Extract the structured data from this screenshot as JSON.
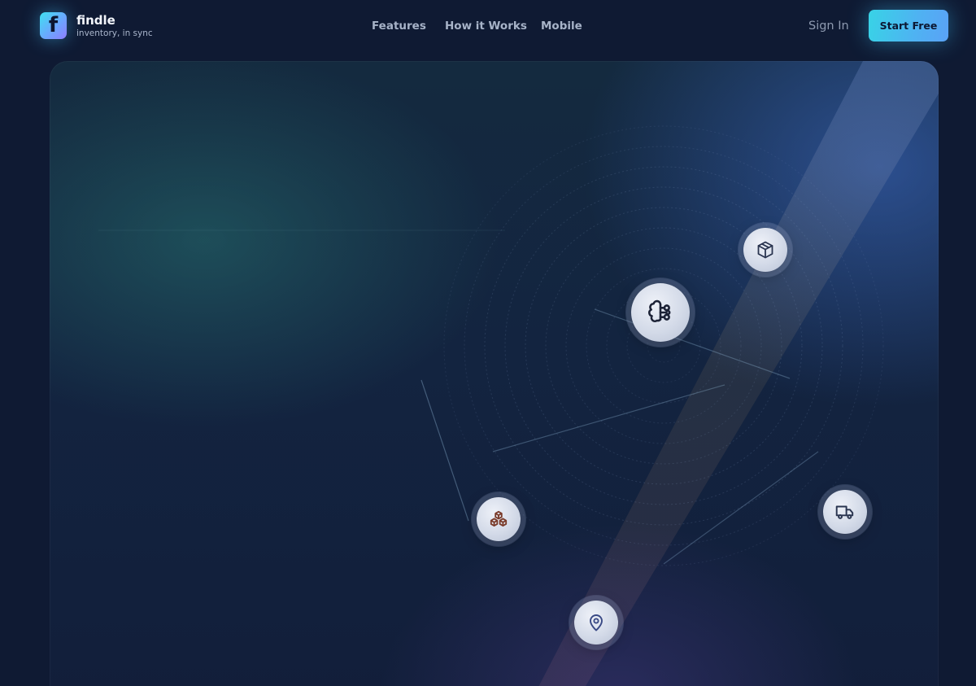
{
  "brand": {
    "logo_letter": "f",
    "name": "findle",
    "tagline": "inventory, in sync"
  },
  "nav": {
    "links": [
      {
        "label": "Features"
      },
      {
        "label": "How it Works"
      },
      {
        "label": "Mobile"
      }
    ],
    "sign_in": "Sign In",
    "cta": "Start Free"
  },
  "hero": {
    "nodes": [
      {
        "id": "core",
        "icon": "brain-icon"
      },
      {
        "id": "package",
        "icon": "package-icon"
      },
      {
        "id": "inventory",
        "icon": "boxes-icon"
      },
      {
        "id": "delivery",
        "icon": "truck-icon"
      },
      {
        "id": "location",
        "icon": "map-pin-icon"
      }
    ]
  },
  "colors": {
    "background": "#0f1a33",
    "accent": "#38d3e6",
    "nav_text": "#a7b3c8",
    "boxes_icon": "#7a3b2a",
    "pin_icon": "#3a4a86"
  }
}
